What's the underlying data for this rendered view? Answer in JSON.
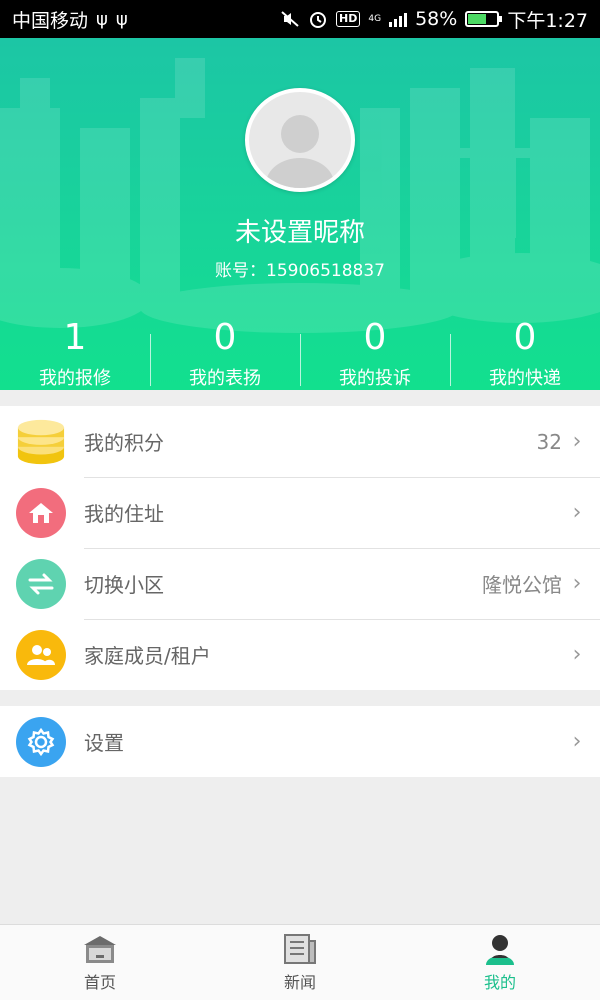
{
  "status_bar": {
    "carrier": "中国移动",
    "network_badge": "HD",
    "network_type": "4G",
    "battery": "58%",
    "time": "下午1:27"
  },
  "profile": {
    "nickname": "未设置昵称",
    "account": "账号：15906518837"
  },
  "stats": [
    {
      "count": "1",
      "label": "我的报修"
    },
    {
      "count": "0",
      "label": "我的表扬"
    },
    {
      "count": "0",
      "label": "我的投诉"
    },
    {
      "count": "0",
      "label": "我的快递"
    }
  ],
  "menu": {
    "points": {
      "label": "我的积分",
      "value": "32",
      "icon": "coins-icon",
      "color": "#f5c518"
    },
    "address": {
      "label": "我的住址",
      "icon": "home-icon",
      "color": "#f26d7d"
    },
    "community": {
      "label": "切换小区",
      "value": "隆悦公馆",
      "icon": "swap-icon",
      "color": "#5fd3b0"
    },
    "family": {
      "label": "家庭成员/租户",
      "icon": "people-icon",
      "color": "#f9b90c"
    },
    "settings": {
      "label": "设置",
      "icon": "gear-icon",
      "color": "#3aa4f0"
    }
  },
  "bottom_nav": [
    {
      "label": "首页",
      "icon": "home-nav-icon",
      "active": false
    },
    {
      "label": "新闻",
      "icon": "news-icon",
      "active": false
    },
    {
      "label": "我的",
      "icon": "user-icon",
      "active": true
    }
  ],
  "colors": {
    "accent": "#1bbf8c",
    "header_top": "#1cc6a5",
    "header_bottom": "#12e08e"
  }
}
